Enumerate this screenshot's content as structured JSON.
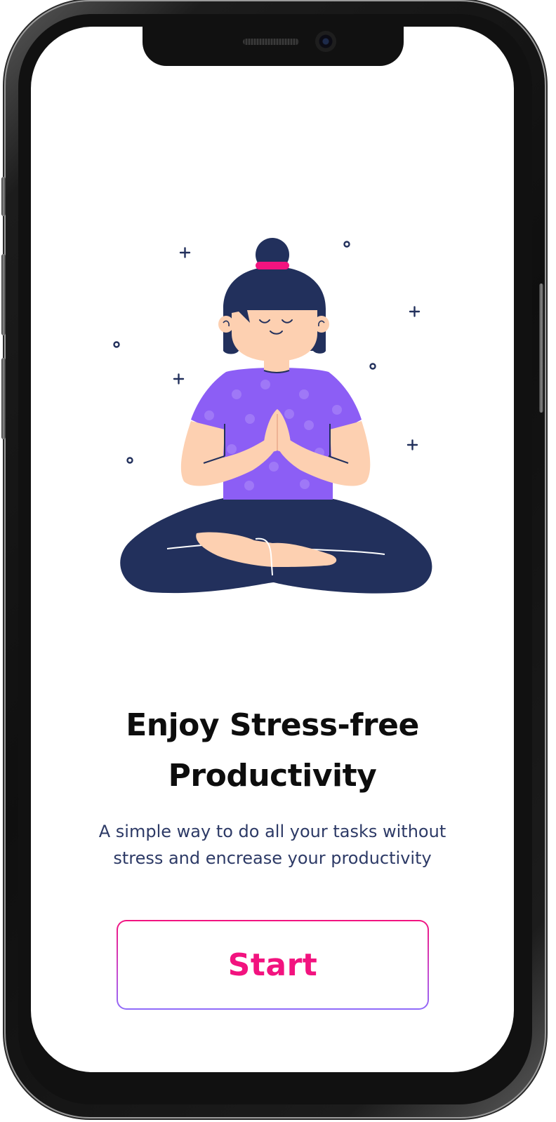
{
  "onboarding": {
    "title_line1": "Enjoy Stress-free",
    "title_line2": "Productivity",
    "subtitle_line1": "A simple way to do all your tasks without",
    "subtitle_line2": "stress and encrease your productivity",
    "start_label": "Start"
  },
  "icons": {
    "illustration": "meditating-woman-illustration",
    "sparkles": "sparkle-plus-icon",
    "dots": "circle-dot-icon"
  },
  "colors": {
    "accent_pink": "#f2137f",
    "accent_purple": "#8f6bfa",
    "navy": "#22305c",
    "shirt_purple": "#8c5ef5",
    "skin": "#fdd0b1",
    "text_dark": "#0d0d0d",
    "text_sub": "#2d3a66"
  }
}
